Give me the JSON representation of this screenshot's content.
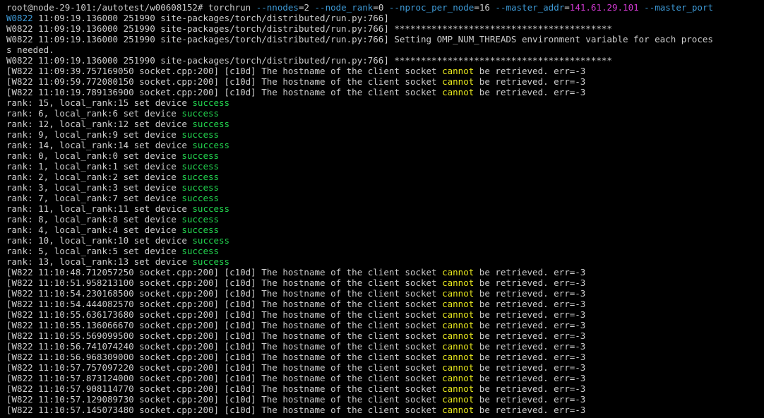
{
  "colors": {
    "background": "#000000",
    "default": "#cccccc",
    "orange_lead": "#e8a64c",
    "blue": "#3e9bd8",
    "yellow": "#e6e61e",
    "green": "#22d44e",
    "magenta": "#d43ad4"
  },
  "terminal": {
    "lines": [
      [
        [
          "root@node-29-101:/autotest/w00608152# torchrun ",
          "default"
        ],
        [
          "--nnodes",
          "blue"
        ],
        [
          "=2 ",
          "default"
        ],
        [
          "--node_rank",
          "blue"
        ],
        [
          "=0 ",
          "default"
        ],
        [
          "--nproc_per_node",
          "blue"
        ],
        [
          "=16 ",
          "default"
        ],
        [
          "--master_addr",
          "blue"
        ],
        [
          "=",
          "default"
        ],
        [
          "141.61.29.101",
          "magenta"
        ],
        [
          " ",
          "default"
        ],
        [
          "--master_port",
          "blue"
        ]
      ],
      [
        [
          "W0822",
          "blue"
        ],
        [
          " 11:09:19.136000 251990 site-packages/torch/distributed/run.py:766]",
          "default"
        ]
      ],
      [
        [
          "W0822 11:09:19.136000 251990 site-packages/torch/distributed/run.py:766] *****************************************",
          "default"
        ]
      ],
      [
        [
          "W0822 11:09:19.136000 251990 site-packages/torch/distributed/run.py:766] Setting OMP_NUM_THREADS environment variable for each proces",
          "default"
        ]
      ],
      [
        [
          "s needed.",
          "default"
        ]
      ],
      [
        [
          "W0822 11:09:19.136000 251990 site-packages/torch/distributed/run.py:766] *****************************************",
          "default"
        ]
      ],
      [
        [
          "[W822 11:09:39.757169050 socket.cpp:200] [c10d] The hostname of the client socket ",
          "default"
        ],
        [
          "cannot",
          "yellow"
        ],
        [
          " be retrieved. err=-3",
          "default"
        ]
      ],
      [
        [
          "[W822 11:09:59.772080150 socket.cpp:200] [c10d] The hostname of the client socket ",
          "default"
        ],
        [
          "cannot",
          "yellow"
        ],
        [
          " be retrieved. err=-3",
          "default"
        ]
      ],
      [
        [
          "[W822 11:10:19.789136900 socket.cpp:200] [c10d] The hostname of the client socket ",
          "default"
        ],
        [
          "cannot",
          "yellow"
        ],
        [
          " be retrieved. err=-3",
          "default"
        ]
      ],
      [
        [
          "rank: 15, local_rank:15 set device ",
          "default"
        ],
        [
          "success",
          "green"
        ]
      ],
      [
        [
          "rank: 6, local_rank:6 set device ",
          "default"
        ],
        [
          "success",
          "green"
        ]
      ],
      [
        [
          "rank: 12, local_rank:12 set device ",
          "default"
        ],
        [
          "success",
          "green"
        ]
      ],
      [
        [
          "rank: 9, local_rank:9 set device ",
          "default"
        ],
        [
          "success",
          "green"
        ]
      ],
      [
        [
          "rank: 14, local_rank:14 set device ",
          "default"
        ],
        [
          "success",
          "green"
        ]
      ],
      [
        [
          "rank: 0, local_rank:0 set device ",
          "default"
        ],
        [
          "success",
          "green"
        ]
      ],
      [
        [
          "rank: 1, local_rank:1 set device ",
          "default"
        ],
        [
          "success",
          "green"
        ]
      ],
      [
        [
          "rank: 2, local_rank:2 set device ",
          "default"
        ],
        [
          "success",
          "green"
        ]
      ],
      [
        [
          "rank: 3, local_rank:3 set device ",
          "default"
        ],
        [
          "success",
          "green"
        ]
      ],
      [
        [
          "rank: 7, local_rank:7 set device ",
          "default"
        ],
        [
          "success",
          "green"
        ]
      ],
      [
        [
          "rank: 11, local_rank:11 set device ",
          "default"
        ],
        [
          "success",
          "green"
        ]
      ],
      [
        [
          "rank: 8, local_rank:8 set device ",
          "default"
        ],
        [
          "success",
          "green"
        ]
      ],
      [
        [
          "rank: 4, local_rank:4 set device ",
          "default"
        ],
        [
          "success",
          "green"
        ]
      ],
      [
        [
          "rank: 10, local_rank:10 set device ",
          "default"
        ],
        [
          "success",
          "green"
        ]
      ],
      [
        [
          "rank: 5, local_rank:5 set device ",
          "default"
        ],
        [
          "success",
          "green"
        ]
      ],
      [
        [
          "rank: 13, local_rank:13 set device ",
          "default"
        ],
        [
          "success",
          "green"
        ]
      ],
      [
        [
          "[W822 11:10:48.712057250 socket.cpp:200] [c10d] The hostname of the client socket ",
          "default"
        ],
        [
          "cannot",
          "yellow"
        ],
        [
          " be retrieved. err=-3",
          "default"
        ]
      ],
      [
        [
          "[W822 11:10:51.958213100 socket.cpp:200] [c10d] The hostname of the client socket ",
          "default"
        ],
        [
          "cannot",
          "yellow"
        ],
        [
          " be retrieved. err=-3",
          "default"
        ]
      ],
      [
        [
          "[W822 11:10:54.230168500 socket.cpp:200] [c10d] The hostname of the client socket ",
          "default"
        ],
        [
          "cannot",
          "yellow"
        ],
        [
          " be retrieved. err=-3",
          "default"
        ]
      ],
      [
        [
          "[W822 11:10:54.444082570 socket.cpp:200] [c10d] The hostname of the client socket ",
          "default"
        ],
        [
          "cannot",
          "yellow"
        ],
        [
          " be retrieved. err=-3",
          "default"
        ]
      ],
      [
        [
          "[W822 11:10:55.636173680 socket.cpp:200] [c10d] The hostname of the client socket ",
          "default"
        ],
        [
          "cannot",
          "yellow"
        ],
        [
          " be retrieved. err=-3",
          "default"
        ]
      ],
      [
        [
          "[W822 11:10:55.136066670 socket.cpp:200] [c10d] The hostname of the client socket ",
          "default"
        ],
        [
          "cannot",
          "yellow"
        ],
        [
          " be retrieved. err=-3",
          "default"
        ]
      ],
      [
        [
          "[W822 11:10:55.569099500 socket.cpp:200] [c10d] The hostname of the client socket ",
          "default"
        ],
        [
          "cannot",
          "yellow"
        ],
        [
          " be retrieved. err=-3",
          "default"
        ]
      ],
      [
        [
          "[W822 11:10:56.741074240 socket.cpp:200] [c10d] The hostname of the client socket ",
          "default"
        ],
        [
          "cannot",
          "yellow"
        ],
        [
          " be retrieved. err=-3",
          "default"
        ]
      ],
      [
        [
          "[W822 11:10:56.968309000 socket.cpp:200] [c10d] The hostname of the client socket ",
          "default"
        ],
        [
          "cannot",
          "yellow"
        ],
        [
          " be retrieved. err=-3",
          "default"
        ]
      ],
      [
        [
          "[W822 11:10:57.757097220 socket.cpp:200] [c10d] The hostname of the client socket ",
          "default"
        ],
        [
          "cannot",
          "yellow"
        ],
        [
          " be retrieved. err=-3",
          "default"
        ]
      ],
      [
        [
          "[W822 11:10:57.873124000 socket.cpp:200] [c10d] The hostname of the client socket ",
          "default"
        ],
        [
          "cannot",
          "yellow"
        ],
        [
          " be retrieved. err=-3",
          "default"
        ]
      ],
      [
        [
          "[W822 11:10:57.908114770 socket.cpp:200] [c10d] The hostname of the client socket ",
          "default"
        ],
        [
          "cannot",
          "yellow"
        ],
        [
          " be retrieved. err=-3",
          "default"
        ]
      ],
      [
        [
          "[W822 11:10:57.129089730 socket.cpp:200] [c10d] The hostname of the client socket ",
          "default"
        ],
        [
          "cannot",
          "yellow"
        ],
        [
          " be retrieved. err=-3",
          "default"
        ]
      ],
      [
        [
          "[W822 11:10:57.145073480 socket.cpp:200] [c10d] The hostname of the client socket ",
          "default"
        ],
        [
          "cannot",
          "yellow"
        ],
        [
          " be retrieved. err=-3",
          "default"
        ]
      ]
    ]
  }
}
